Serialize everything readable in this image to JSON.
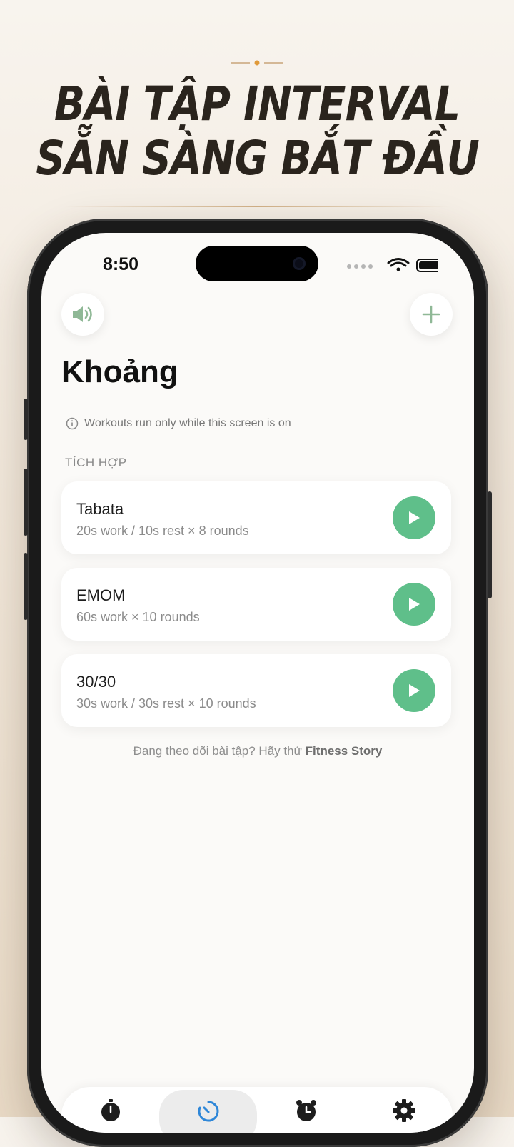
{
  "headline": {
    "line1": "BÀI TẬP INTERVAL",
    "line2": "SẴN SÀNG BẮT ĐẦU"
  },
  "status_bar": {
    "time": "8:50",
    "icons": [
      "cellular-dots-icon",
      "wifi-icon",
      "battery-icon"
    ]
  },
  "toolbar": {
    "sound_icon": "speaker-icon",
    "add_icon": "plus-icon"
  },
  "page": {
    "title": "Khoảng",
    "notice": "Workouts run only while this screen is on",
    "section_label": "TÍCH HỢP"
  },
  "presets": [
    {
      "name": "Tabata",
      "description": "20s work / 10s rest × 8 rounds"
    },
    {
      "name": "EMOM",
      "description": "60s work × 10 rounds"
    },
    {
      "name": "30/30",
      "description": "30s work / 30s rest × 10 rounds"
    }
  ],
  "promo": {
    "text": "Đang theo dõi bài tập? Hãy thử ",
    "link": "Fitness Story"
  },
  "tabs": [
    {
      "icon": "stopwatch-icon",
      "active": false
    },
    {
      "icon": "interval-timer-icon",
      "active": true
    },
    {
      "icon": "alarm-clock-icon",
      "active": false
    },
    {
      "icon": "gear-icon",
      "active": false
    }
  ],
  "colors": {
    "accent_green": "#5fbf8a",
    "active_tab_blue": "#2f87d8",
    "ornament_orange": "#e09a3a"
  }
}
